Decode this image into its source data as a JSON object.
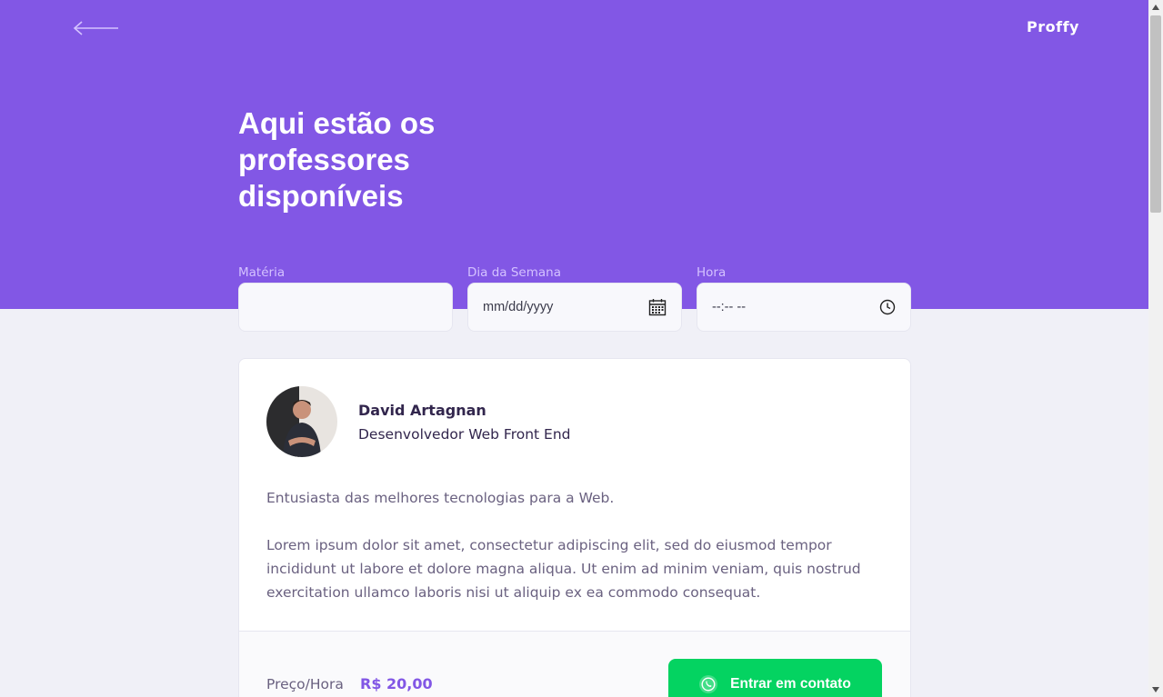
{
  "header": {
    "logo": "Proffy",
    "title": "Aqui estão os professores disponíveis",
    "back_icon": "arrow-left-icon"
  },
  "filters": {
    "subject": {
      "label": "Matéria",
      "value": ""
    },
    "weekday": {
      "label": "Dia da Semana",
      "placeholder": "mm/dd/yyyy",
      "icon": "calendar-icon"
    },
    "time": {
      "label": "Hora",
      "placeholder": "--:-- --",
      "icon": "clock-icon"
    }
  },
  "teacher": {
    "name": "David Artagnan",
    "subject": "Desenvolvedor Web Front End",
    "bio_intro": "Entusiasta das melhores tecnologias para a Web.",
    "bio_body": "Lorem ipsum dolor sit amet, consectetur adipiscing elit, sed do eiusmod tempor incididunt ut labore et dolore magna aliqua. Ut enim ad minim veniam, quis nostrud exercitation ullamco laboris nisi ut aliquip ex ea commodo consequat.",
    "price_label": "Preço/Hora",
    "price_value": "R$ 20,00",
    "contact_label": "Entrar em contato",
    "contact_icon": "whatsapp-icon"
  },
  "colors": {
    "primary": "#8257E5",
    "background": "#F0F0F7",
    "secondary": "#04D361",
    "title_text": "#32264D",
    "body_text": "#6A6180"
  }
}
